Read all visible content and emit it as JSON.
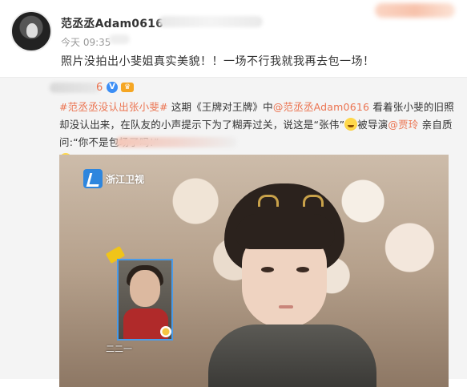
{
  "post": {
    "username": "范丞丞Adam0616",
    "time": "今天 09:35",
    "text": "照片没拍出小斐姐真实美貌！！一场不行我就我再去包一场！"
  },
  "repost": {
    "author_suffix": "6",
    "topic": "#范丞丞没认出张小斐#",
    "text_1": " 这期《王牌对王牌》中",
    "mention_1": "@范丞丞Adam0616",
    "text_2": " 看着张小斐的旧照却没认出来，在队友的小声提示下为了糊弄过关，说这是“张伟”",
    "text_3": "被导演",
    "mention_2": "@贾玲",
    "text_4": " 亲自质问:“你不是包场了吗!”"
  },
  "video": {
    "channel_logo_text": "浙江卫视",
    "inset_caption": "二二一"
  },
  "icons": {
    "verified": "v-badge-icon",
    "member": "crown-icon",
    "emoji": "laughing-emoji-icon"
  },
  "colors": {
    "link": "#eb7350",
    "verified": "#3c8ef5",
    "repost_bg": "#f4f4f4"
  }
}
